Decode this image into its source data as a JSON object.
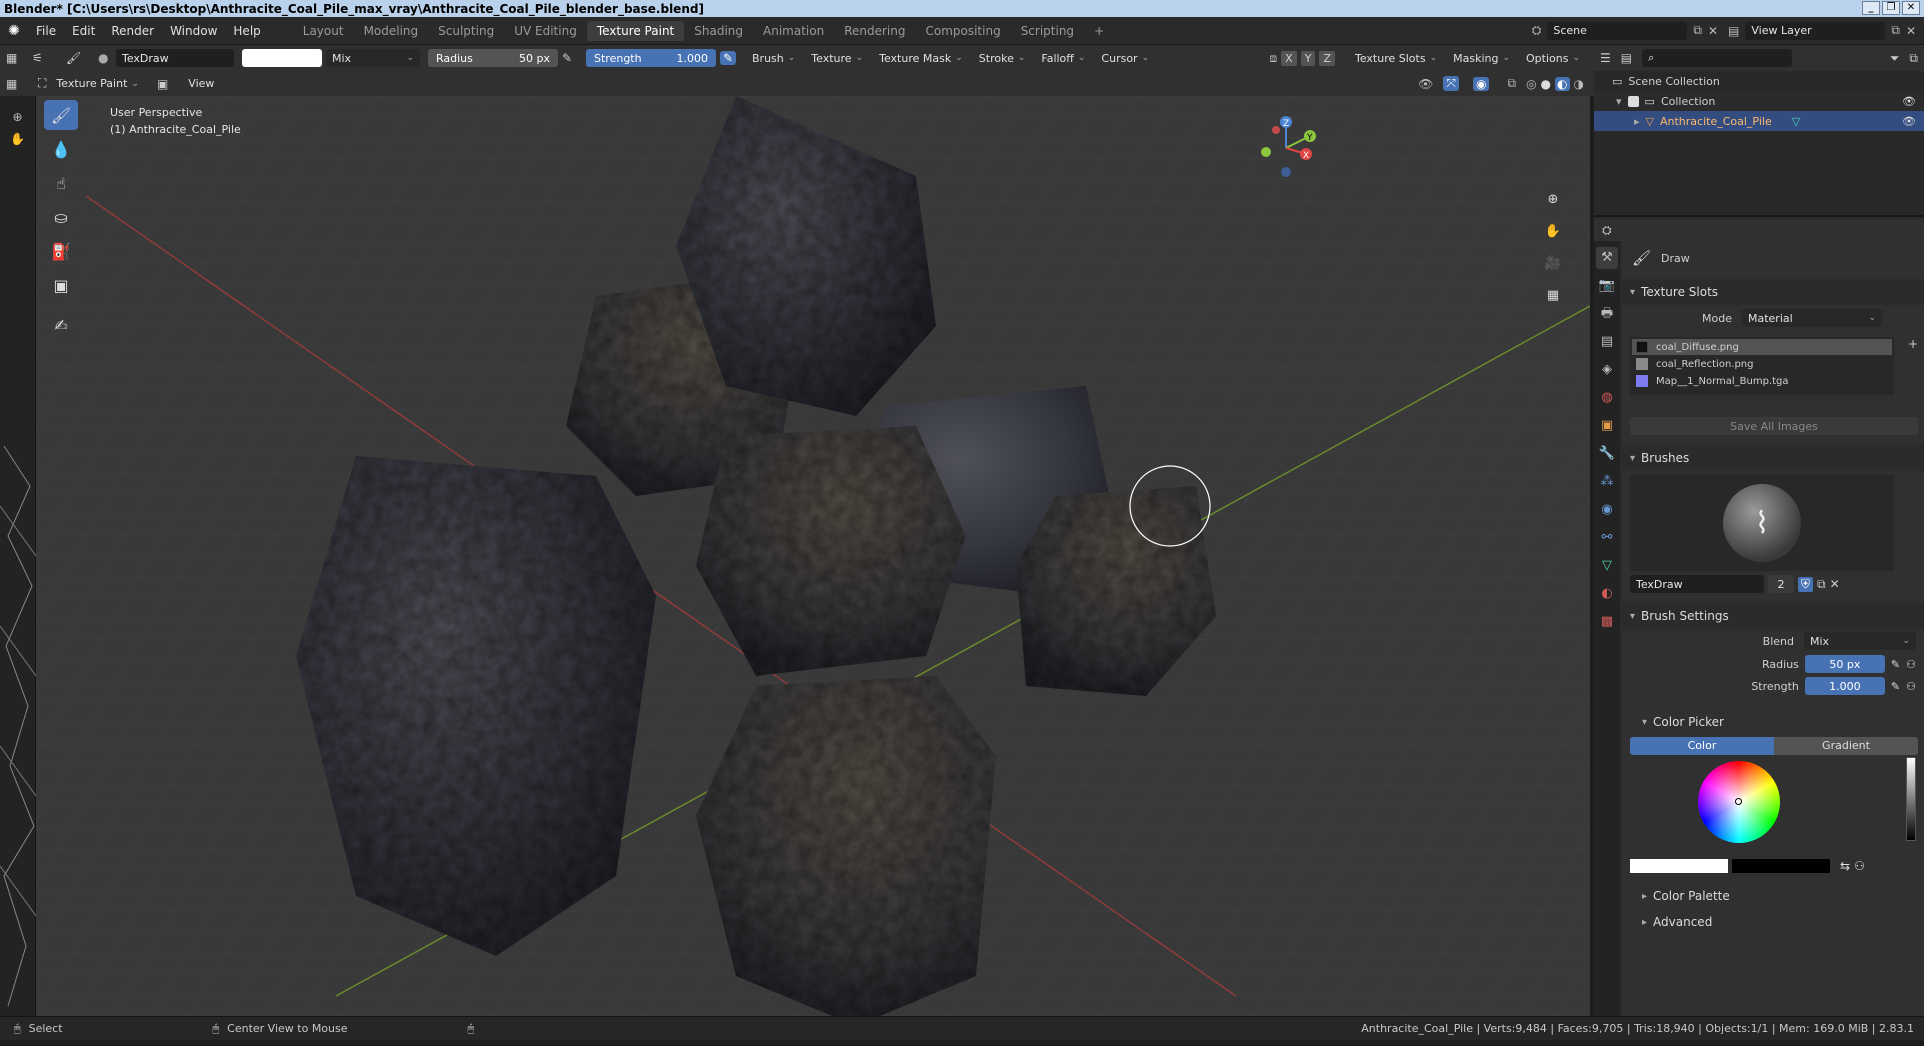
{
  "window": {
    "title": "Blender* [C:\\Users\\rs\\Desktop\\Anthracite_Coal_Pile_max_vray\\Anthracite_Coal_Pile_blender_base.blend]"
  },
  "menu": {
    "items": [
      "File",
      "Edit",
      "Render",
      "Window",
      "Help"
    ]
  },
  "workspaces": {
    "tabs": [
      "Layout",
      "Modeling",
      "Sculpting",
      "UV Editing",
      "Texture Paint",
      "Shading",
      "Animation",
      "Rendering",
      "Compositing",
      "Scripting"
    ],
    "active": "Texture Paint"
  },
  "scene": {
    "label": "Scene",
    "view_layer": "View Layer"
  },
  "tool_header": {
    "brush_name": "TexDraw",
    "blend": "Mix",
    "radius_label": "Radius",
    "radius_value": "50 px",
    "strength_label": "Strength",
    "strength_value": "1.000",
    "strength_fill": 1.0,
    "menus": [
      "Brush",
      "Texture",
      "Texture Mask",
      "Stroke",
      "Falloff",
      "Cursor"
    ],
    "axes": [
      "X",
      "Y",
      "Z"
    ],
    "right_menus": [
      "Texture Slots",
      "Masking",
      "Options"
    ],
    "color_swatch": "#ffffff"
  },
  "view_header": {
    "mode": "Texture Paint",
    "view": "View"
  },
  "viewport": {
    "perspective": "User Perspective",
    "object_label": "(1) Anthracite_Coal_Pile"
  },
  "outliner": {
    "scene_collection": "Scene Collection",
    "collection": "Collection",
    "object": "Anthracite_Coal_Pile"
  },
  "properties": {
    "tool_name": "Draw",
    "texture_slots_title": "Texture Slots",
    "mode_label": "Mode",
    "mode_value": "Material",
    "slots": [
      {
        "name": "coal_Diffuse.png",
        "color": "#111111"
      },
      {
        "name": "coal_Reflection.png",
        "color": "#8a8a8a"
      },
      {
        "name": "Map__1_Normal_Bump.tga",
        "color": "#7c7cf0"
      }
    ],
    "save_all": "Save All Images",
    "brushes_title": "Brushes",
    "brush_name": "TexDraw",
    "brush_users": "2",
    "brush_settings_title": "Brush Settings",
    "blend_label": "Blend",
    "blend_value": "Mix",
    "radius_label": "Radius",
    "radius_value": "50 px",
    "strength_label": "Strength",
    "strength_value": "1.000",
    "color_picker_title": "Color Picker",
    "color_tab": "Color",
    "gradient_tab": "Gradient",
    "color_palette": "Color Palette",
    "advanced": "Advanced"
  },
  "status": {
    "left": "Select",
    "middle": "Center View to Mouse",
    "right": "Anthracite_Coal_Pile | Verts:9,484 | Faces:9,705 | Tris:18,940 | Objects:1/1 | Mem: 169.0 MiB | 2.83.1"
  },
  "colors": {
    "accent": "#4772b3",
    "background": "#393939",
    "selected": "#334d80"
  }
}
